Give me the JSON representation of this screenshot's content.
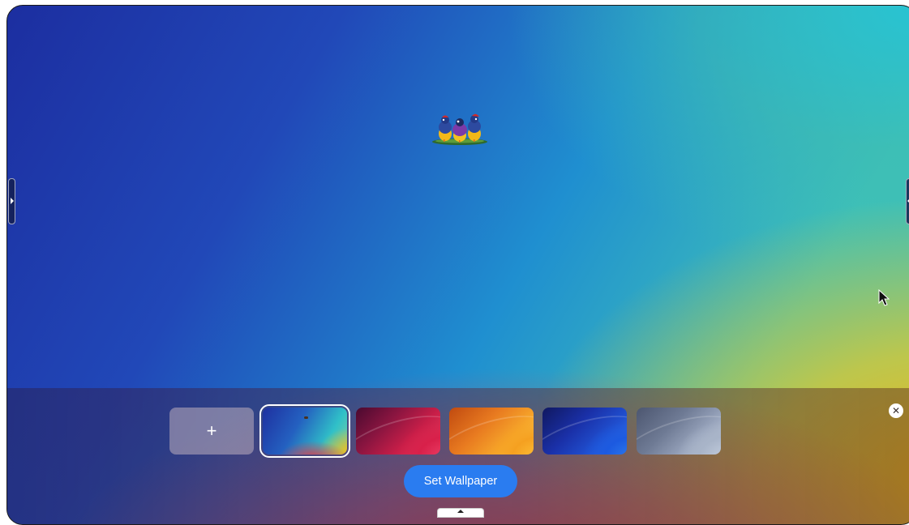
{
  "desktop": {
    "background_colors": {
      "top_left": "#1c2ea0",
      "top_right": "#28c4d0",
      "bottom_right": "#f0b21a",
      "bottom_center": "#e03848"
    },
    "logo_icon": "three-birds-logo-icon",
    "left_handle_icon": "chevron-right-icon",
    "right_handle_icon": "chevron-left-icon",
    "cursor_icon": "mouse-pointer-icon"
  },
  "wallpaper_picker": {
    "add_label": "+",
    "thumbnails": [
      {
        "name": "current-gradient",
        "selected": true
      },
      {
        "name": "crimson-waves",
        "selected": false
      },
      {
        "name": "orange-waves",
        "selected": false
      },
      {
        "name": "blue-waves",
        "selected": false
      },
      {
        "name": "gray-waves",
        "selected": false
      }
    ],
    "set_button_label": "Set Wallpaper",
    "close_icon": "close-circle-icon",
    "collapse_icon": "chevron-up-icon",
    "accent_color": "#2a7cf0"
  }
}
